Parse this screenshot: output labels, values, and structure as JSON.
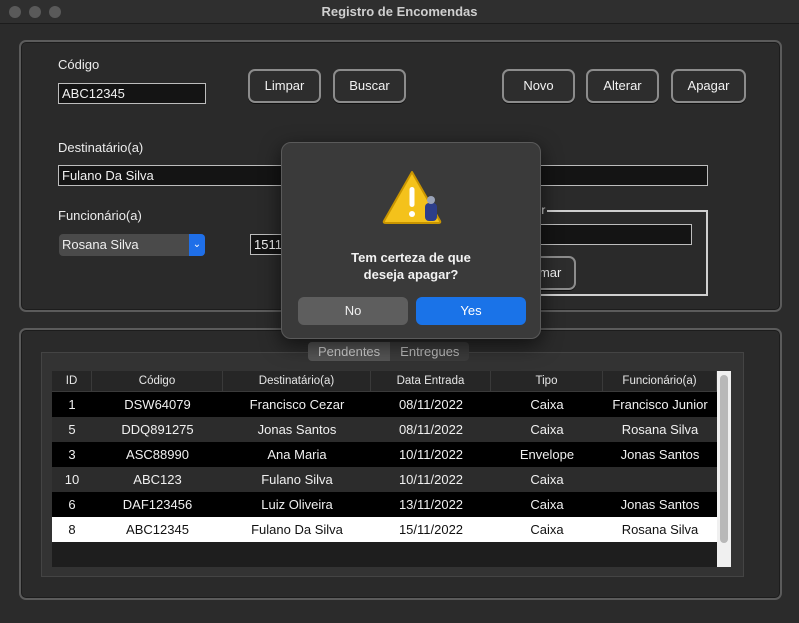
{
  "window": {
    "title": "Registro de Encomendas"
  },
  "form": {
    "codigo_label": "Código",
    "codigo_value": "ABC12345",
    "buttons": {
      "limpar": "Limpar",
      "buscar": "Buscar",
      "novo": "Novo",
      "alterar": "Alterar",
      "apagar": "Apagar"
    },
    "destinatario_label": "Destinatário(a)",
    "destinatario_value": "Fulano Da Silva",
    "funcionario_label": "Funcionário(a)",
    "funcionario_value": "Rosana Silva",
    "data_value_partial": "1511",
    "group_legend_partial": "por",
    "confirm_button_partial": "rmar"
  },
  "tabs": [
    "Pendentes",
    "Entregues"
  ],
  "table": {
    "columns": [
      "ID",
      "Código",
      "Destinatário(a)",
      "Data Entrada",
      "Tipo",
      "Funcionário(a)"
    ],
    "rows": [
      [
        "1",
        "DSW64079",
        "Francisco Cezar",
        "08/11/2022",
        "Caixa",
        "Francisco Junior"
      ],
      [
        "5",
        "DDQ891275",
        "Jonas Santos",
        "08/11/2022",
        "Caixa",
        "Rosana Silva"
      ],
      [
        "3",
        "ASC88990",
        "Ana Maria",
        "10/11/2022",
        "Envelope",
        "Jonas Santos"
      ],
      [
        "10",
        "ABC123",
        "Fulano Silva",
        "10/11/2022",
        "Caixa",
        ""
      ],
      [
        "6",
        "DAF123456",
        "Luiz Oliveira",
        "13/11/2022",
        "Caixa",
        "Jonas Santos"
      ],
      [
        "8",
        "ABC12345",
        "Fulano Da Silva",
        "15/11/2022",
        "Caixa",
        "Rosana Silva"
      ]
    ],
    "selected_row": 5
  },
  "dialog": {
    "icon": "warning-icon",
    "message_line1": "Tem certeza de que",
    "message_line2": "deseja apagar?",
    "no_label": "No",
    "yes_label": "Yes"
  }
}
